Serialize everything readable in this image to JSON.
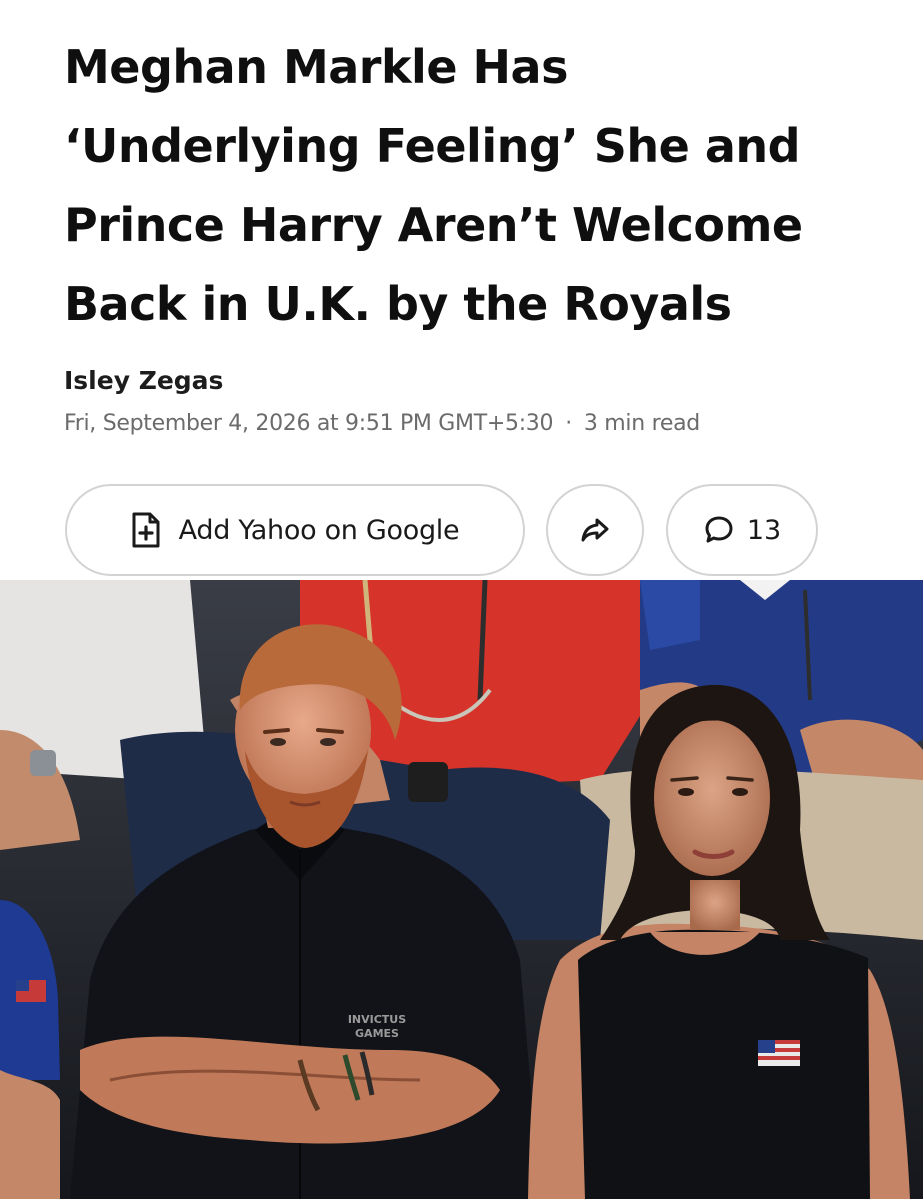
{
  "article": {
    "headline_lines": [
      "Meghan Markle Has",
      "‘Underlying Feeling’ She and",
      "Prince Harry Aren’t Welcome",
      "Back in U.K. by the Royals"
    ],
    "author": "Isley Zegas",
    "timestamp": "Fri, September 4, 2026 at 9:51 PM GMT+5:30",
    "read_time": "3 min read"
  },
  "actions": {
    "add_google_label": "Add Yahoo on Google",
    "comment_count": "13"
  },
  "photo": {
    "shirt_logo_line1": "INVICTUS",
    "shirt_logo_line2": "GAMES"
  },
  "icons": {
    "add_google": "document-plus-icon",
    "share": "share-arrow-icon",
    "comments": "speech-bubble-icon"
  },
  "colors": {
    "headline": "#0f0f0f",
    "meta": "#6b6b6b",
    "pill_border": "#d3d3d3"
  }
}
